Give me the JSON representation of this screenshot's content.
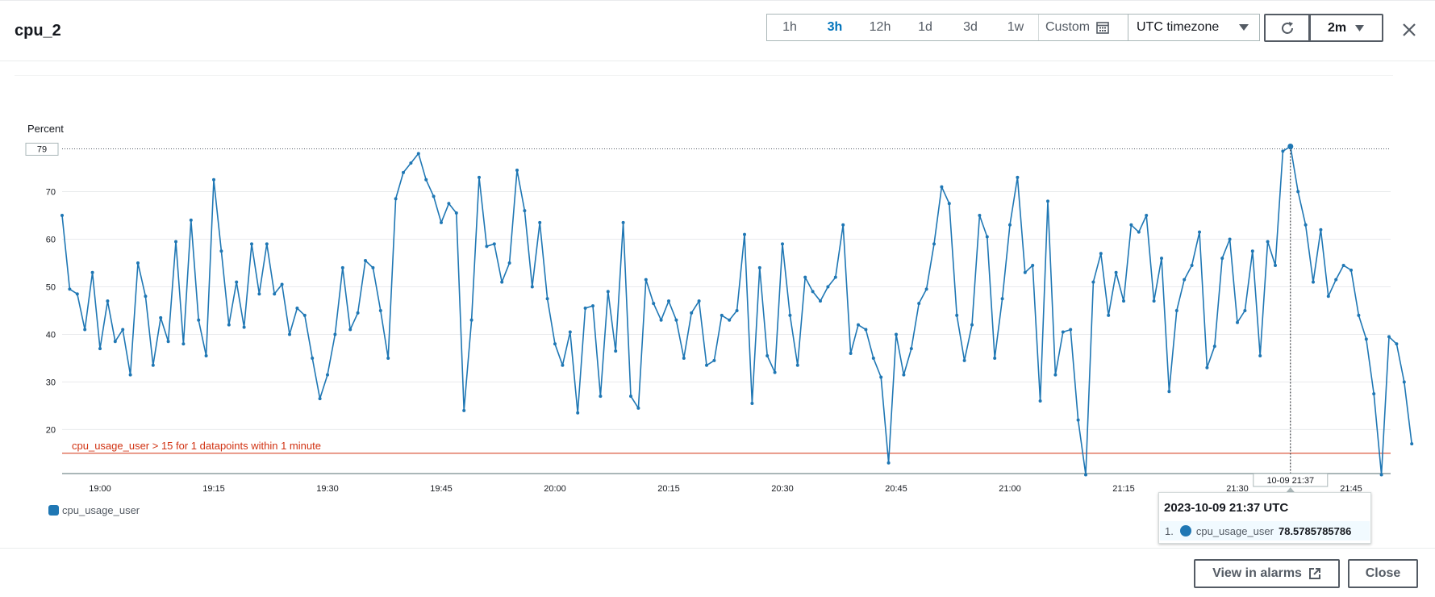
{
  "header": {
    "title": "cpu_2",
    "ranges": [
      {
        "label": "1h",
        "active": false
      },
      {
        "label": "3h",
        "active": true
      },
      {
        "label": "12h",
        "active": false
      },
      {
        "label": "1d",
        "active": false
      },
      {
        "label": "3d",
        "active": false
      },
      {
        "label": "1w",
        "active": false
      }
    ],
    "custom_label": "Custom",
    "timezone_label": "UTC timezone",
    "refresh_interval": "2m"
  },
  "chart_data": {
    "type": "line",
    "ylabel": "Percent",
    "y_ticks": [
      20,
      30,
      40,
      50,
      60,
      70
    ],
    "max_label": "79",
    "ylim": [
      10,
      79
    ],
    "x_ticks": [
      "19:00",
      "19:15",
      "19:30",
      "19:45",
      "20:00",
      "20:15",
      "20:30",
      "20:45",
      "21:00",
      "21:15",
      "21:30",
      "21:45"
    ],
    "x_start": "18:55",
    "x_end": "21:50",
    "step_minutes": 1,
    "grid": true,
    "series": [
      {
        "name": "cpu_usage_user",
        "color": "#1f77b4",
        "values": [
          65,
          49.5,
          48.5,
          41,
          53,
          37,
          47,
          38.5,
          41,
          31.5,
          55,
          48,
          33.5,
          43.5,
          38.5,
          59.5,
          38,
          64,
          43,
          35.5,
          72.5,
          57.5,
          42,
          51,
          41.5,
          59,
          48.5,
          59,
          48.5,
          50.5,
          40,
          45.5,
          44,
          35,
          26.5,
          31.5,
          40,
          54,
          41,
          44.5,
          55.5,
          54,
          45,
          35,
          68.5,
          74,
          76,
          78,
          72.5,
          69,
          63.5,
          67.5,
          65.5,
          24,
          43,
          73,
          58.5,
          59,
          51,
          55,
          74.5,
          66,
          50,
          63.5,
          47.5,
          38,
          33.5,
          40.5,
          23.5,
          45.5,
          46,
          27,
          49,
          36.5,
          63.5,
          27,
          24.5,
          51.5,
          46.5,
          43,
          47,
          43,
          35,
          44.5,
          47,
          33.5,
          34.5,
          44,
          43,
          45,
          61,
          25.5,
          54,
          35.5,
          32,
          59,
          44,
          33.5,
          52,
          49,
          47,
          50,
          52,
          63,
          36,
          42,
          41,
          35,
          31,
          13,
          40,
          31.5,
          37,
          46.5,
          49.5,
          59,
          71,
          67.5,
          44,
          34.5,
          42,
          65,
          60.5,
          35,
          47.5,
          63,
          73,
          53,
          54.5,
          26,
          68,
          31.5,
          40.5,
          41,
          22,
          10.5,
          51,
          57,
          44,
          53,
          47,
          63,
          61.5,
          65,
          47,
          56,
          28,
          45,
          51.5,
          54.5,
          61.5,
          33,
          37.5,
          56,
          60,
          42.5,
          45,
          57.5,
          35.5,
          59.5,
          54.5,
          78.5,
          79.5,
          70,
          63,
          51,
          62,
          48,
          51.5,
          54.5,
          53.5,
          44,
          39,
          27.5,
          10.5,
          39.5,
          38,
          30,
          17
        ]
      }
    ],
    "threshold": {
      "value": 15,
      "color": "#d13212",
      "label": "cpu_usage_user > 15 for 1 datapoints within 1 minute"
    },
    "crosshair": {
      "time_label": "10-09 21:37",
      "index": 162
    }
  },
  "legend": {
    "items": [
      {
        "label": "cpu_usage_user",
        "color": "#1f77b4"
      }
    ]
  },
  "tooltip": {
    "title": "2023-10-09 21:37 UTC",
    "rows": [
      {
        "index": "1.",
        "label": "cpu_usage_user",
        "value": "78.5785785786",
        "color": "#1f77b4"
      }
    ]
  },
  "footer": {
    "view_in_alarms_label": "View in alarms",
    "close_label": "Close"
  }
}
